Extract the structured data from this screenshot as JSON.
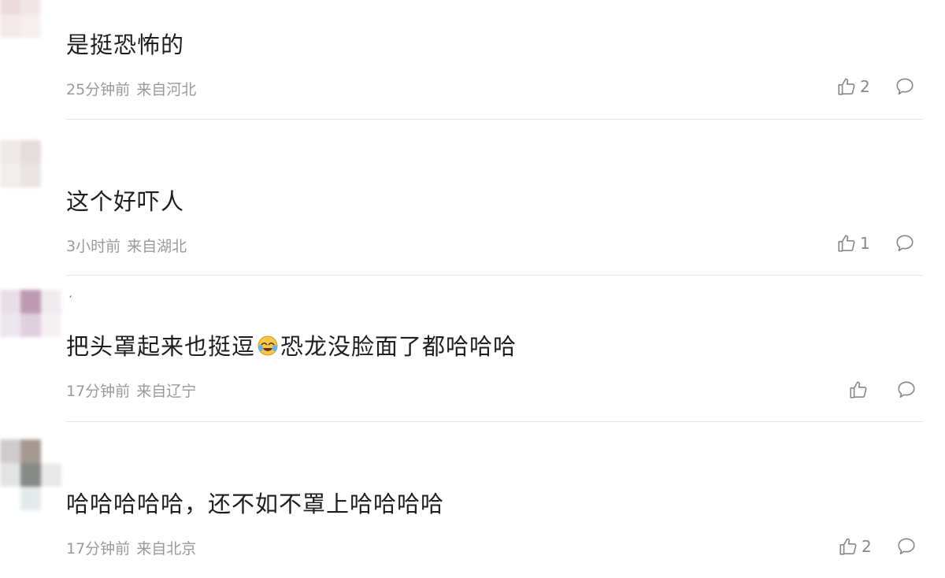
{
  "comments": [
    {
      "text": "是挺恐怖的",
      "time": "25分钟前",
      "location": "来自河北",
      "likes": "2"
    },
    {
      "text": "这个好吓人",
      "time": "3小时前",
      "location": "来自湖北",
      "likes": "1"
    },
    {
      "name_mark": "′",
      "text_before": "把头罩起来也挺逗",
      "emoji": "laughing-crying-emoji",
      "text_after": "恐龙没脸面了都哈哈哈",
      "time": "17分钟前",
      "location": "来自辽宁",
      "likes": ""
    },
    {
      "text": "哈哈哈哈哈，还不如不罩上哈哈哈哈",
      "time": "17分钟前",
      "location": "来自北京",
      "likes": "2"
    }
  ],
  "icons": {
    "like": "thumbs-up-icon",
    "reply": "comment-bubble-icon"
  },
  "colors": {
    "meta": "#9a9a9a",
    "icon": "#888888",
    "divider": "#e6e6e6"
  }
}
